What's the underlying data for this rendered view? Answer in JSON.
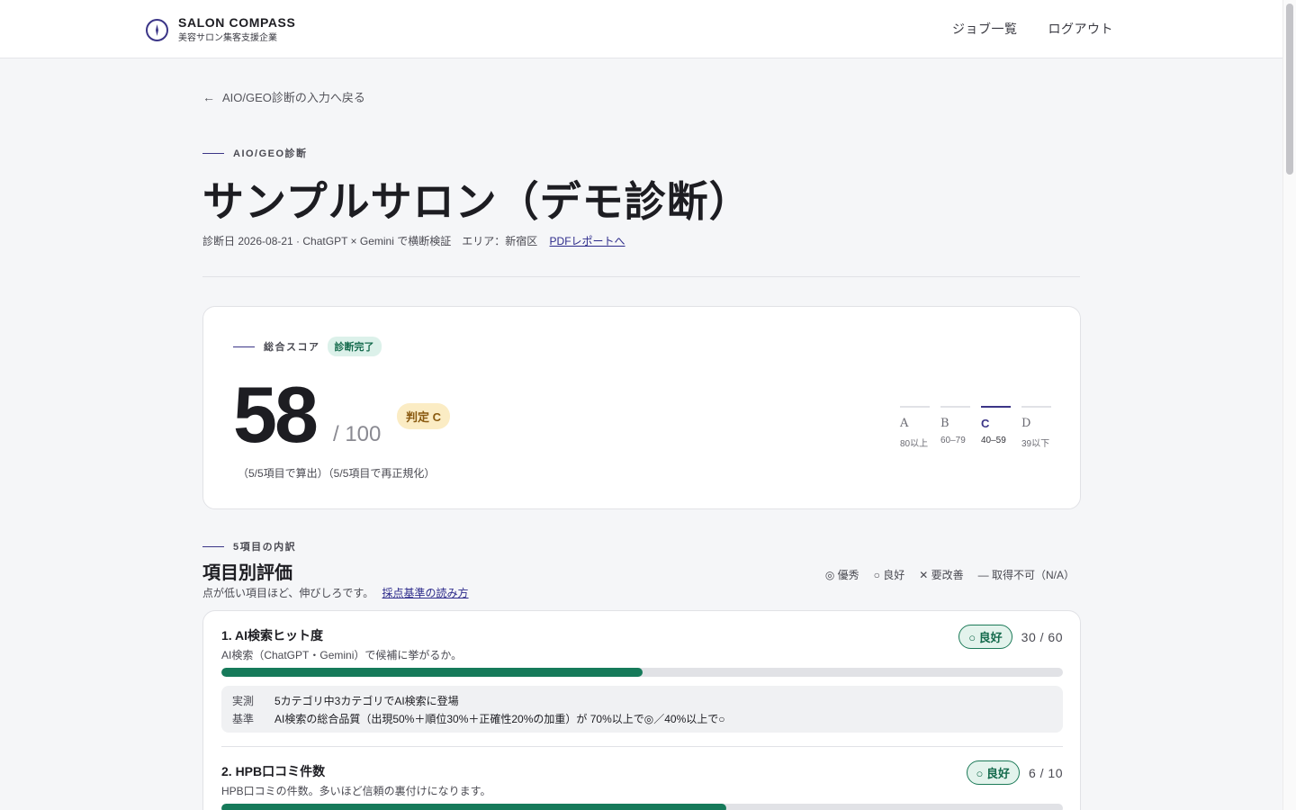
{
  "header": {
    "brand_name": "SALON COMPASS",
    "brand_sub": "美容サロン集客支援企業",
    "nav": [
      "ジョブ一覧",
      "ログアウト"
    ]
  },
  "back_link": "AIO/GEO診断の入力へ戻る",
  "page": {
    "eyebrow": "AIO/GEO診断",
    "title": "サンプルサロン（デモ診断）",
    "meta": "診断日 2026-08-21 · ChatGPT × Gemini で横断検証　エリア：新宿区",
    "pdf_link": "PDFレポートへ"
  },
  "score": {
    "eyebrow": "総合スコア",
    "status": "診断完了",
    "value": "58",
    "max": "/ 100",
    "grade": "判定 C",
    "note": "（5/5項目で算出）（5/5項目で再正規化）",
    "scale": [
      {
        "letter": "A",
        "range": "80以上",
        "active": false
      },
      {
        "letter": "B",
        "range": "60–79",
        "active": false
      },
      {
        "letter": "C",
        "range": "40–59",
        "active": true
      },
      {
        "letter": "D",
        "range": "39以下",
        "active": false
      }
    ]
  },
  "breakdown": {
    "eyebrow": "5項目の内訳",
    "title": "項目別評価",
    "desc": "点が低い項目ほど、伸びしろです。",
    "desc_link": "採点基準の読み方",
    "legend": [
      "◎ 優秀",
      "○ 良好",
      "✕ 要改善",
      "— 取得不可（N/A）"
    ]
  },
  "items": [
    {
      "title": "1. AI検索ヒット度",
      "desc": "AI検索（ChatGPT・Gemini）で候補に挙がるか。",
      "rating": "○ 良好",
      "points": "30 / 60",
      "fill": 0.5,
      "measured_label": "実測",
      "measured": "5カテゴリ中3カテゴリでAI検索に登場",
      "criteria_label": "基準",
      "criteria": "AI検索の総合品質（出現50%＋順位30%＋正確性20%の加重）が 70%以上で◎／40%以上で○"
    },
    {
      "title": "2. HPB口コミ件数",
      "desc": "HPB口コミの件数。多いほど信頼の裏付けになります。",
      "rating": "○ 良好",
      "points": "6 / 10",
      "fill": 0.6
    }
  ],
  "colors": {
    "accent": "#3b3587",
    "good": "#167a5a",
    "grade_bg": "#fbecc4"
  }
}
